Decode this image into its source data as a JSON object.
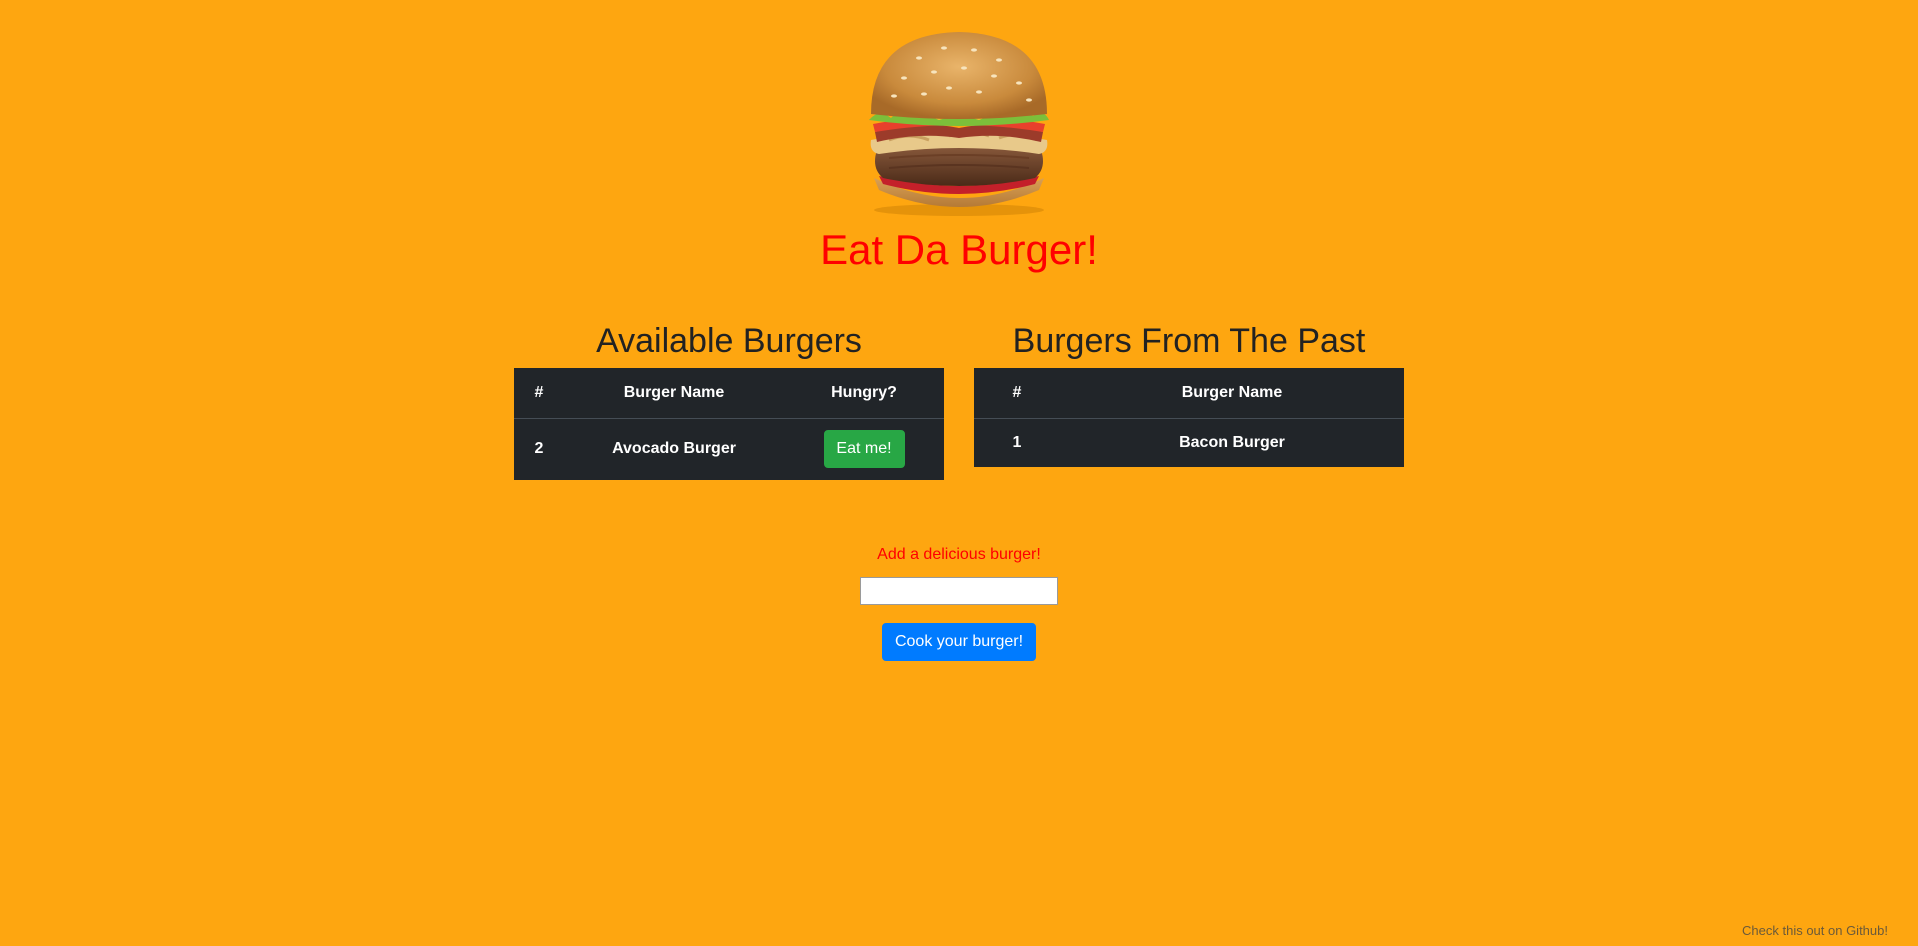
{
  "header": {
    "image_alt": "Burger",
    "title": "Eat Da Burger!"
  },
  "available": {
    "title": "Available Burgers",
    "columns": [
      "#",
      "Burger Name",
      "Hungry?"
    ],
    "rows": [
      {
        "id": "2",
        "name": "Avocado Burger",
        "action": "Eat me!"
      }
    ]
  },
  "past": {
    "title": "Burgers From The Past",
    "columns": [
      "#",
      "Burger Name"
    ],
    "rows": [
      {
        "id": "1",
        "name": "Bacon Burger"
      }
    ]
  },
  "form": {
    "label": "Add a delicious burger!",
    "input_value": "",
    "input_placeholder": "",
    "submit_label": "Cook your burger!"
  },
  "footer": {
    "link_text": "Check this out on Github!"
  },
  "colors": {
    "background": "#fea610",
    "title": "#ff0000",
    "table": "#212529",
    "eat_button": "#28a745",
    "cook_button": "#007bff"
  },
  "icons": [
    "burger-image"
  ]
}
